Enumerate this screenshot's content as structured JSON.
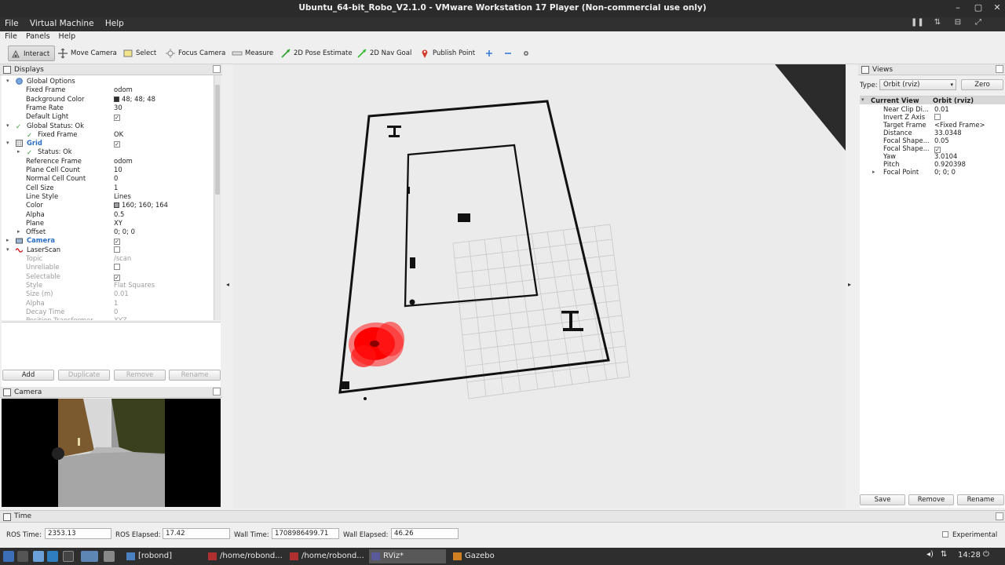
{
  "window": {
    "title": "Ubuntu_64-bit_Robo_V2.1.0 - VMware Workstation 17 Player (Non-commercial use only)",
    "menus": [
      "File",
      "Virtual Machine",
      "Help"
    ]
  },
  "rviz_menus": [
    "File",
    "Panels",
    "Help"
  ],
  "toolbar": {
    "tools": [
      {
        "label": "Interact",
        "icon": "interact-icon",
        "active": true
      },
      {
        "label": "Move Camera",
        "icon": "move-camera-icon"
      },
      {
        "label": "Select",
        "icon": "select-icon"
      },
      {
        "label": "Focus Camera",
        "icon": "focus-camera-icon"
      },
      {
        "label": "Measure",
        "icon": "measure-icon"
      },
      {
        "label": "2D Pose Estimate",
        "icon": "pose-arrow-icon"
      },
      {
        "label": "2D Nav Goal",
        "icon": "goal-arrow-icon"
      },
      {
        "label": "Publish Point",
        "icon": "map-pin-icon"
      }
    ]
  },
  "displays": {
    "title": "Displays",
    "rows": [
      {
        "indent": 0,
        "expand": "▾",
        "icon": "globe",
        "key": "Global Options",
        "value": ""
      },
      {
        "indent": 1,
        "key": "Fixed Frame",
        "value": "odom"
      },
      {
        "indent": 1,
        "key": "Background Color",
        "value": "48; 48; 48",
        "swatch": "#303030"
      },
      {
        "indent": 1,
        "key": "Frame Rate",
        "value": "30"
      },
      {
        "indent": 1,
        "key": "Default Light",
        "check": true
      },
      {
        "indent": 0,
        "expand": "▾",
        "icon": "tick",
        "key": "Global Status: Ok",
        "value": ""
      },
      {
        "indent": 1,
        "icon": "tick",
        "key": "Fixed Frame",
        "value": "OK"
      },
      {
        "indent": 0,
        "expand": "▾",
        "icon": "grid",
        "key": "Grid",
        "check": true,
        "style": "blue"
      },
      {
        "indent": 1,
        "expand": "▸",
        "icon": "tick",
        "key": "Status: Ok",
        "value": ""
      },
      {
        "indent": 1,
        "key": "Reference Frame",
        "value": "odom"
      },
      {
        "indent": 1,
        "key": "Plane Cell Count",
        "value": "10"
      },
      {
        "indent": 1,
        "key": "Normal Cell Count",
        "value": "0"
      },
      {
        "indent": 1,
        "key": "Cell Size",
        "value": "1"
      },
      {
        "indent": 1,
        "key": "Line Style",
        "value": "Lines"
      },
      {
        "indent": 1,
        "key": "Color",
        "value": "160; 160; 164",
        "swatch": "#a0a0a4"
      },
      {
        "indent": 1,
        "key": "Alpha",
        "value": "0.5"
      },
      {
        "indent": 1,
        "key": "Plane",
        "value": "XY"
      },
      {
        "indent": 1,
        "expand": "▸",
        "key": "Offset",
        "value": "0; 0; 0"
      },
      {
        "indent": 0,
        "expand": "▸",
        "icon": "camera",
        "key": "Camera",
        "check": true,
        "style": "blue"
      },
      {
        "indent": 0,
        "expand": "▾",
        "icon": "laser",
        "key": "LaserScan",
        "check": false
      },
      {
        "indent": 1,
        "key": "Topic",
        "value": "/scan",
        "style": "dim"
      },
      {
        "indent": 1,
        "key": "Unreliable",
        "check": false,
        "style": "dim"
      },
      {
        "indent": 1,
        "key": "Selectable",
        "check": true,
        "style": "dim"
      },
      {
        "indent": 1,
        "key": "Style",
        "value": "Flat Squares",
        "style": "dim"
      },
      {
        "indent": 1,
        "key": "Size (m)",
        "value": "0.01",
        "style": "dim"
      },
      {
        "indent": 1,
        "key": "Alpha",
        "value": "1",
        "style": "dim"
      },
      {
        "indent": 1,
        "key": "Decay Time",
        "value": "0",
        "style": "dim"
      },
      {
        "indent": 1,
        "key": "Position Transformer",
        "value": "XYZ",
        "style": "dim"
      }
    ],
    "buttons": [
      {
        "label": "Add",
        "enabled": true
      },
      {
        "label": "Duplicate",
        "enabled": false
      },
      {
        "label": "Remove",
        "enabled": false
      },
      {
        "label": "Rename",
        "enabled": false
      }
    ]
  },
  "camera_panel": {
    "title": "Camera"
  },
  "views": {
    "title": "Views",
    "type_label": "Type:",
    "type_value": "Orbit (rviz)",
    "zero_label": "Zero",
    "header_key": "Current View",
    "header_value": "Orbit (rviz)",
    "rows": [
      {
        "key": "Near Clip Di...",
        "value": "0.01"
      },
      {
        "key": "Invert Z Axis",
        "check": false
      },
      {
        "key": "Target Frame",
        "value": "<Fixed Frame>"
      },
      {
        "key": "Distance",
        "value": "33.0348"
      },
      {
        "key": "Focal Shape...",
        "value": "0.05"
      },
      {
        "key": "Focal Shape...",
        "check": true
      },
      {
        "key": "Yaw",
        "value": "3.0104"
      },
      {
        "key": "Pitch",
        "value": "0.920398"
      },
      {
        "key": "Focal Point",
        "value": "0; 0; 0",
        "expand": "▸"
      }
    ],
    "buttons": [
      "Save",
      "Remove",
      "Rename"
    ]
  },
  "time": {
    "title": "Time",
    "ros_time_label": "ROS Time:",
    "ros_time": "2353.13",
    "ros_elapsed_label": "ROS Elapsed:",
    "ros_elapsed": "17.42",
    "wall_time_label": "Wall Time:",
    "wall_time": "1708986499.71",
    "wall_elapsed_label": "Wall Elapsed:",
    "wall_elapsed": "46.26",
    "experimental_label": "Experimental"
  },
  "taskbar": {
    "tasks": [
      {
        "label": "[robond]",
        "color": "#4a7fc0"
      },
      {
        "label": "/home/robond...",
        "color": "#b03030"
      },
      {
        "label": "/home/robond...",
        "color": "#b03030"
      },
      {
        "label": "RViz*",
        "color": "#5a5a9a",
        "active": true
      },
      {
        "label": "Gazebo",
        "color": "#d08020"
      }
    ],
    "clock": "14:28"
  }
}
